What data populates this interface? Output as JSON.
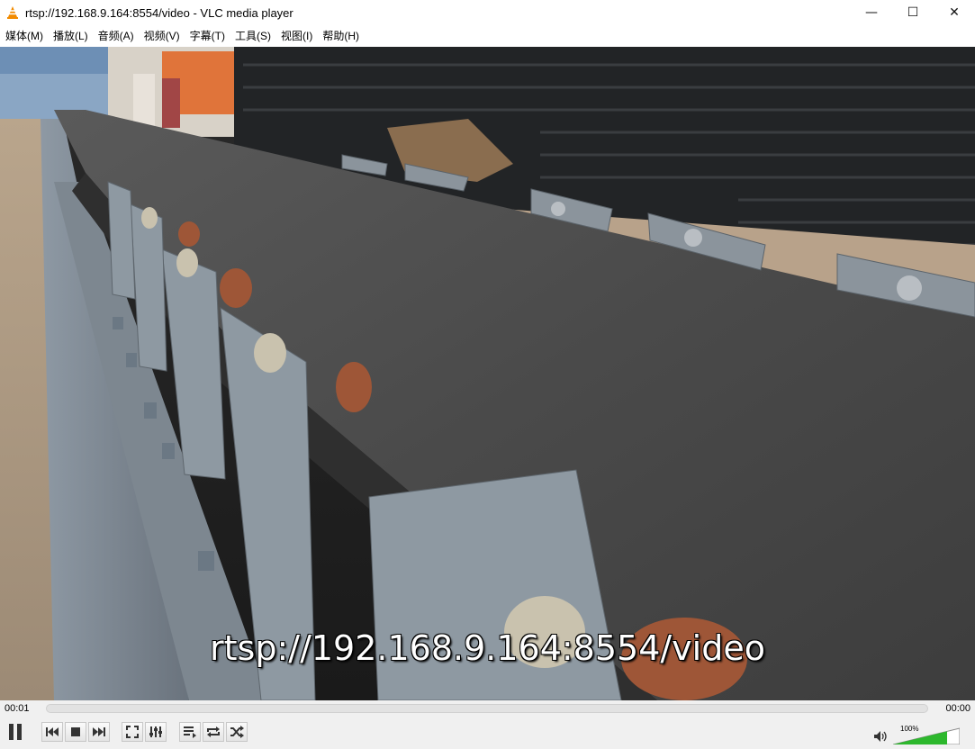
{
  "window": {
    "title": "rtsp://192.168.9.164:8554/video - VLC media player",
    "minimize_glyph": "—",
    "maximize_glyph": "☐",
    "close_glyph": "✕"
  },
  "menu": {
    "items": [
      {
        "label": "媒体(M)"
      },
      {
        "label": "播放(L)"
      },
      {
        "label": "音频(A)"
      },
      {
        "label": "视频(V)"
      },
      {
        "label": "字幕(T)"
      },
      {
        "label": "工具(S)"
      },
      {
        "label": "视图(I)"
      },
      {
        "label": "帮助(H)"
      }
    ]
  },
  "video": {
    "subtitle": "rtsp://192.168.9.164:8554/video",
    "scene": "conveyor-belt-factory-frame"
  },
  "seek": {
    "elapsed": "00:01",
    "total": "00:00",
    "progress": 0
  },
  "controls": {
    "buttons": [
      {
        "name": "pause-icon"
      },
      {
        "name": "previous-icon"
      },
      {
        "name": "stop-icon"
      },
      {
        "name": "next-icon"
      },
      {
        "name": "fullscreen-icon"
      },
      {
        "name": "extended-settings-icon"
      },
      {
        "name": "playlist-icon"
      },
      {
        "name": "loop-icon"
      },
      {
        "name": "shuffle-icon"
      }
    ],
    "volume": {
      "label": "100%",
      "level": 1.0,
      "color": "#2db82d"
    }
  },
  "colors": {
    "vlc_orange": "#f28b00",
    "chrome_bg": "#f0f0f0"
  }
}
